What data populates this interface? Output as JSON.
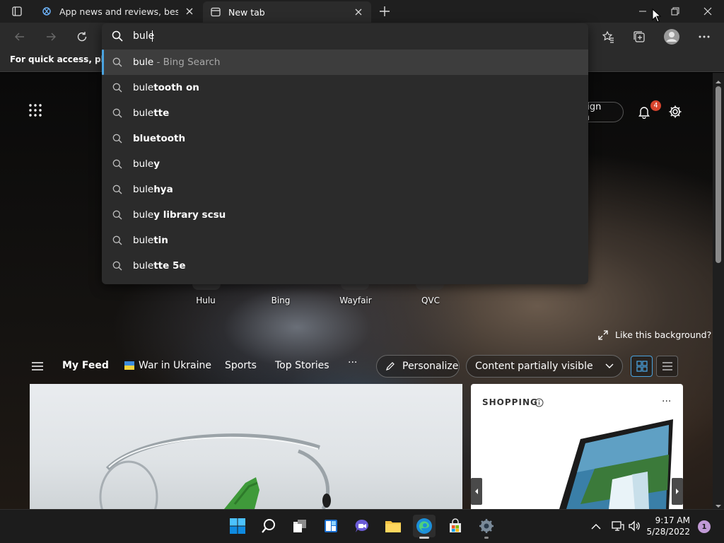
{
  "browser": {
    "tabs": [
      {
        "title": "App news and reviews, best softw",
        "active": false
      },
      {
        "title": "New tab",
        "active": true
      }
    ],
    "favorites_bar_text": "For quick access, place y",
    "address_value": "bule"
  },
  "omnibox": {
    "suggestions": [
      {
        "typed": "bule",
        "rest": "",
        "suffix": " - Bing Search",
        "selected": true
      },
      {
        "typed": "bule",
        "rest": "tooth on",
        "suffix": ""
      },
      {
        "typed": "bule",
        "rest": "tte",
        "suffix": ""
      },
      {
        "typed": "",
        "rest": "bluetooth",
        "suffix": ""
      },
      {
        "typed": "bule",
        "rest": "y",
        "suffix": ""
      },
      {
        "typed": "bule",
        "rest": "hya",
        "suffix": ""
      },
      {
        "typed": "bule",
        "rest": "y library scsu",
        "suffix": ""
      },
      {
        "typed": "bule",
        "rest": "tin",
        "suffix": ""
      },
      {
        "typed": "bule",
        "rest": "tte 5e",
        "suffix": ""
      }
    ]
  },
  "ntp": {
    "sign_in": "Sign in",
    "notification_count": "4",
    "quick_links": [
      "Hulu",
      "Bing",
      "Wayfair",
      "QVC"
    ],
    "like_background": "Like this background?",
    "feed_tabs": {
      "my_feed": "My Feed",
      "war": "War in Ukraine",
      "sports": "Sports",
      "top_stories": "Top Stories",
      "more": "···"
    },
    "personalize": "Personalize",
    "content_visibility": "Content partially visible",
    "shopping_title": "SHOPPING",
    "shopping_more": "···"
  },
  "taskbar": {
    "time": "9:17 AM",
    "date": "5/28/2022",
    "notification_count": "1"
  },
  "colors": {
    "accent": "#4aa3df",
    "chrome_bg": "#2b2b2b",
    "titlebar_bg": "#1f1f1f",
    "badge_red": "#d8442d",
    "taskbar_bg": "#1c1c1c"
  }
}
